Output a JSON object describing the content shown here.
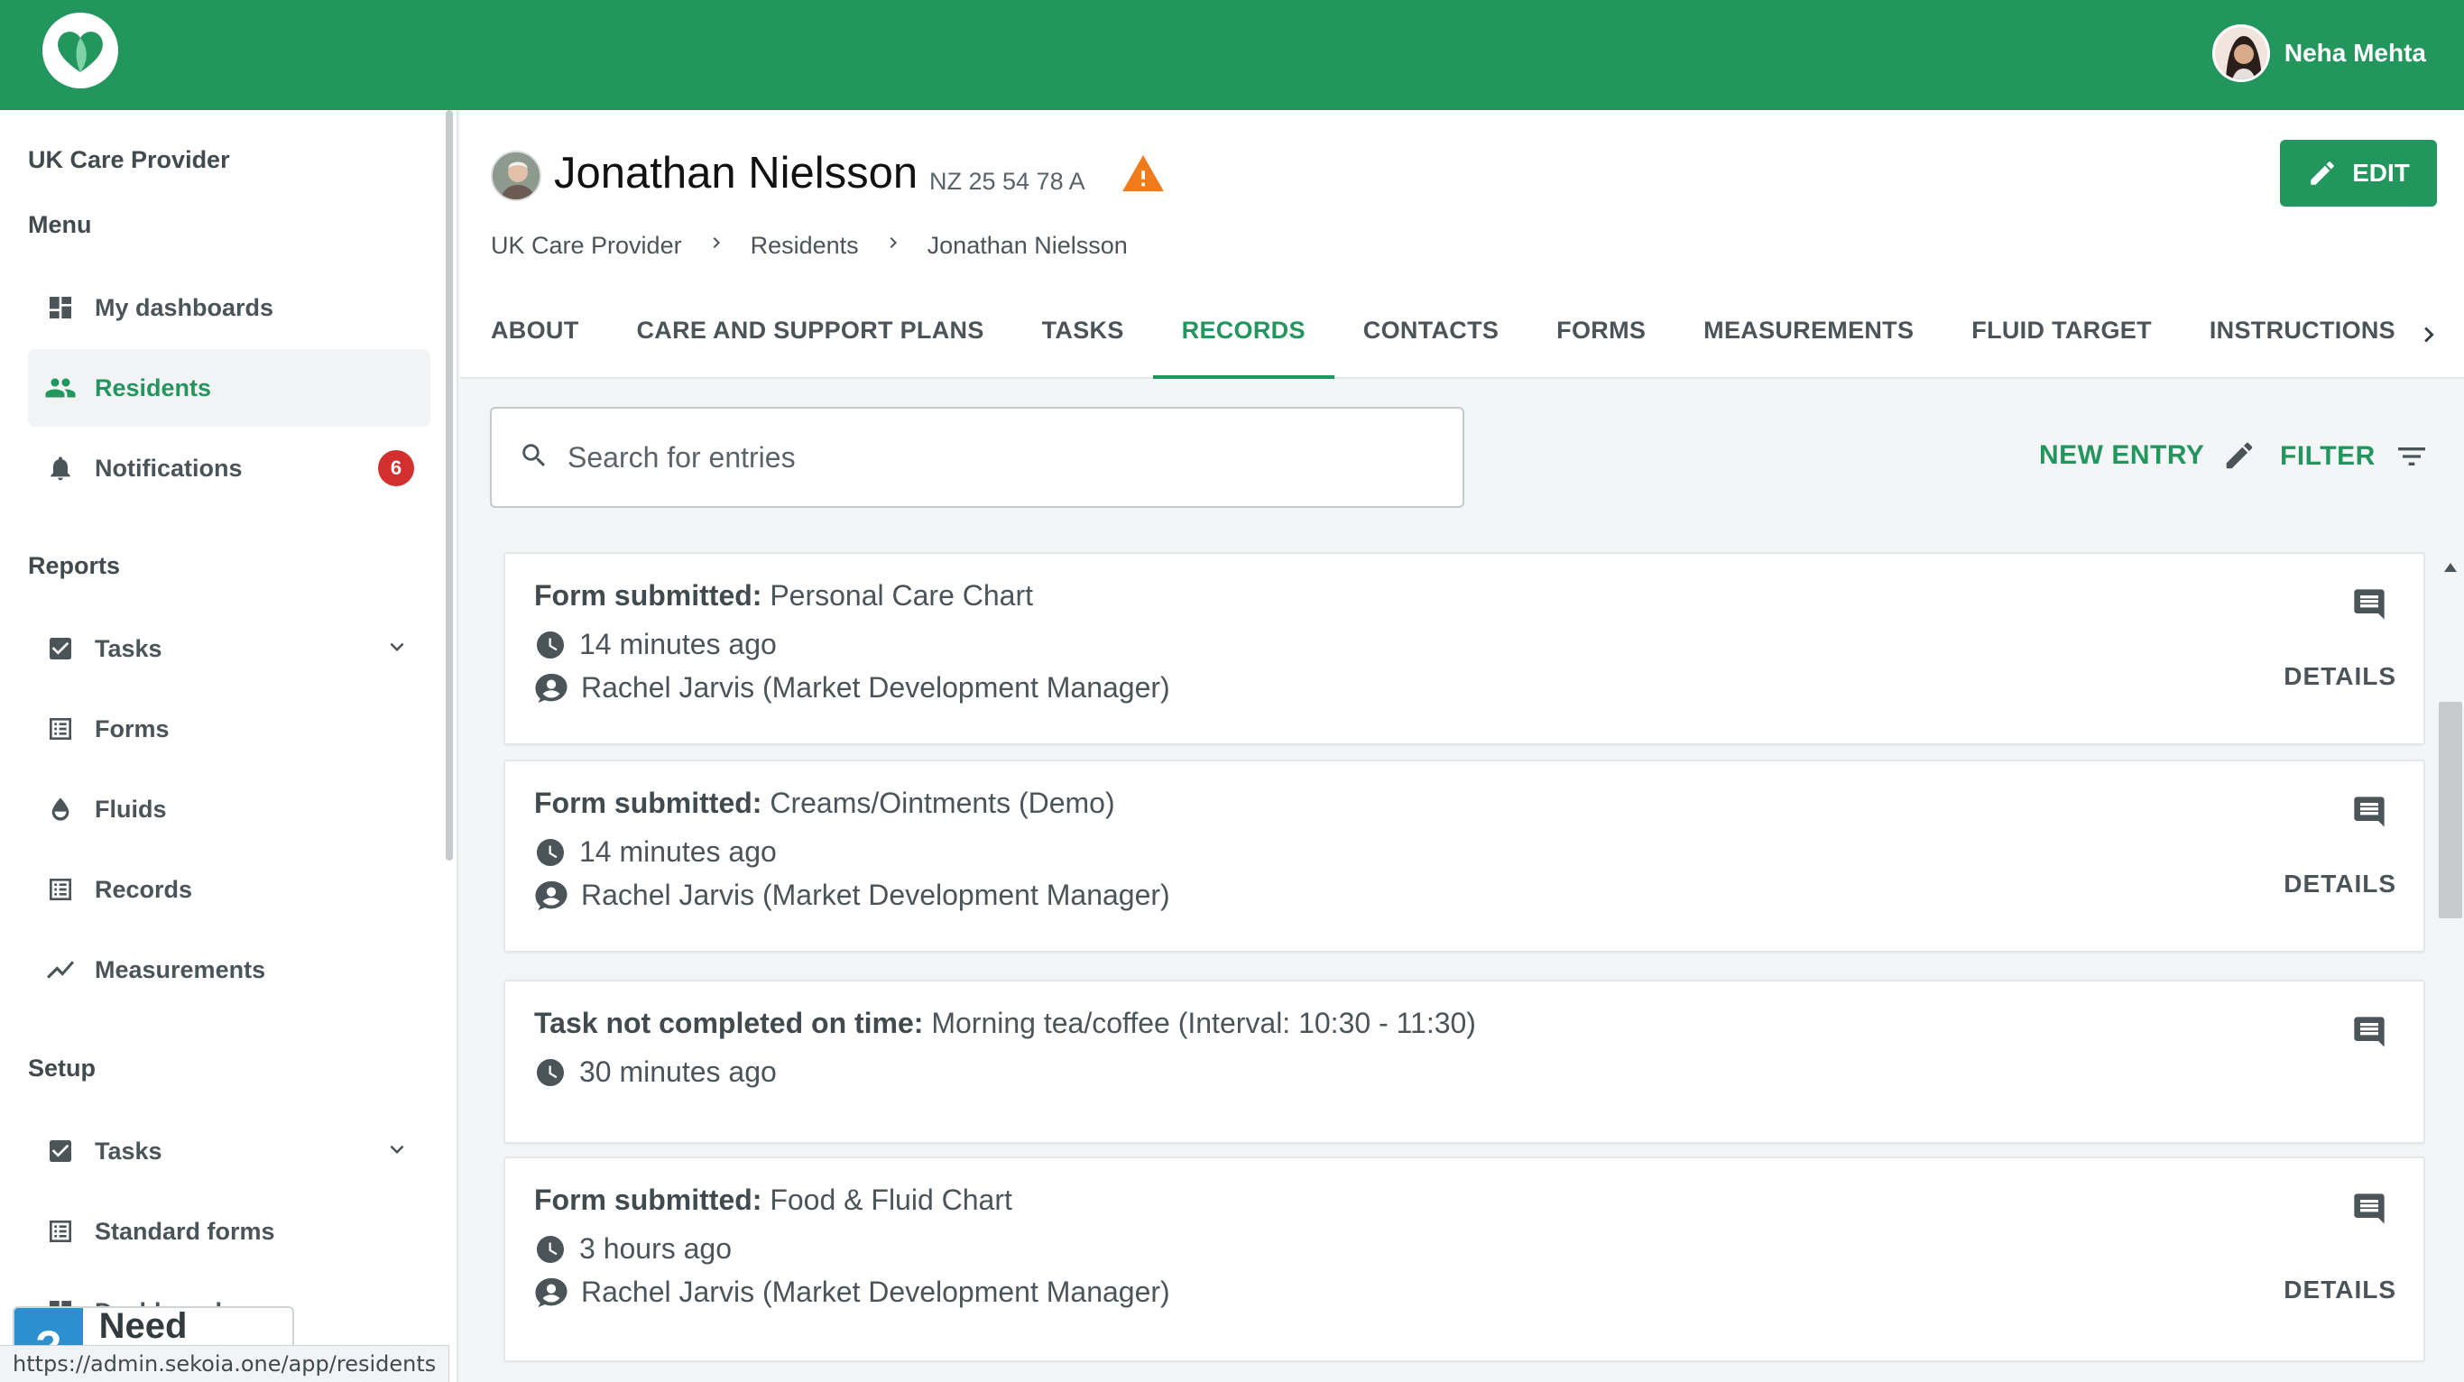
{
  "app": {
    "user_name": "Neha Mehta",
    "brand_color": "#23965e",
    "logo_icon": "heart-leaf-logo"
  },
  "sidebar": {
    "org": "UK Care Provider",
    "menu_heading": "Menu",
    "menu_items": [
      {
        "label": "My dashboards",
        "icon": "dashboard-icon"
      },
      {
        "label": "Residents",
        "icon": "people-icon",
        "active": true
      },
      {
        "label": "Notifications",
        "icon": "bell-icon",
        "badge": "6"
      }
    ],
    "reports_heading": "Reports",
    "reports_items": [
      {
        "label": "Tasks",
        "icon": "checkbox-icon",
        "expandable": true
      },
      {
        "label": "Forms",
        "icon": "list-icon"
      },
      {
        "label": "Fluids",
        "icon": "drop-icon"
      },
      {
        "label": "Records",
        "icon": "list-icon"
      },
      {
        "label": "Measurements",
        "icon": "trend-icon"
      }
    ],
    "setup_heading": "Setup",
    "setup_items": [
      {
        "label": "Tasks",
        "icon": "checkbox-icon",
        "expandable": true
      },
      {
        "label": "Standard forms",
        "icon": "list-icon"
      },
      {
        "label": "Dashboard",
        "icon": "dashboard-icon"
      }
    ],
    "help_q": "?",
    "help_label": "Need help?"
  },
  "status_url": "https://admin.sekoia.one/app/residents",
  "resident": {
    "name": "Jonathan Nielsson",
    "id": "NZ 25 54 78 A",
    "edit_label": "EDIT"
  },
  "breadcrumb": [
    "UK Care Provider",
    "Residents",
    "Jonathan Nielsson"
  ],
  "tabs": [
    {
      "label": "ABOUT"
    },
    {
      "label": "CARE AND SUPPORT PLANS"
    },
    {
      "label": "TASKS"
    },
    {
      "label": "RECORDS",
      "active": true
    },
    {
      "label": "CONTACTS"
    },
    {
      "label": "FORMS"
    },
    {
      "label": "MEASUREMENTS"
    },
    {
      "label": "FLUID TARGET"
    },
    {
      "label": "INSTRUCTIONS"
    }
  ],
  "toolbar": {
    "search_placeholder": "Search for entries",
    "new_entry_label": "NEW ENTRY",
    "filter_label": "FILTER"
  },
  "records": [
    {
      "kind": "Form submitted:",
      "title": "Personal Care Chart",
      "time": "14 minutes ago",
      "author": "Rachel Jarvis (Market Development Manager)",
      "details_label": "DETAILS"
    },
    {
      "kind": "Form submitted:",
      "title": "Creams/Ointments (Demo)",
      "time": "14 minutes ago",
      "author": "Rachel Jarvis (Market Development Manager)",
      "details_label": "DETAILS"
    },
    {
      "kind": "Task not completed on time:",
      "title": "Morning tea/coffee (Interval: 10:30 - 11:30)",
      "time": "30 minutes ago"
    },
    {
      "kind": "Form submitted:",
      "title": "Food & Fluid Chart",
      "time": "3 hours ago",
      "author": "Rachel Jarvis (Market Development Manager)",
      "details_label": "DETAILS"
    }
  ]
}
